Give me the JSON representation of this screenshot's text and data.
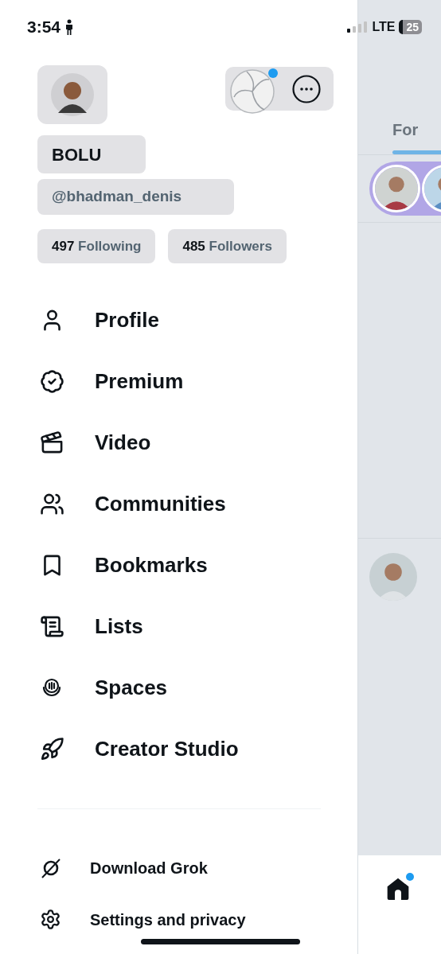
{
  "status_bar": {
    "time": "3:54",
    "network": "LTE",
    "battery": "25"
  },
  "profile": {
    "name": "BOLU",
    "handle": "@bhadman_denis",
    "stats": [
      {
        "count": "497",
        "label": "Following"
      },
      {
        "count": "485",
        "label": "Followers"
      }
    ]
  },
  "menu": [
    {
      "label": "Profile",
      "kind": "user"
    },
    {
      "label": "Premium",
      "kind": "badge"
    },
    {
      "label": "Video",
      "kind": "video"
    },
    {
      "label": "Communities",
      "kind": "people"
    },
    {
      "label": "Bookmarks",
      "kind": "bookmark"
    },
    {
      "label": "Lists",
      "kind": "list"
    },
    {
      "label": "Spaces",
      "kind": "spaces"
    },
    {
      "label": "Creator Studio",
      "kind": "rocket"
    }
  ],
  "bottom_menu": [
    {
      "label": "Download Grok",
      "kind": "grok"
    },
    {
      "label": "Settings and privacy",
      "kind": "gear"
    }
  ],
  "background_feed": {
    "tabs": [
      {
        "label": "For",
        "selected": true
      }
    ],
    "home_notification": true
  }
}
